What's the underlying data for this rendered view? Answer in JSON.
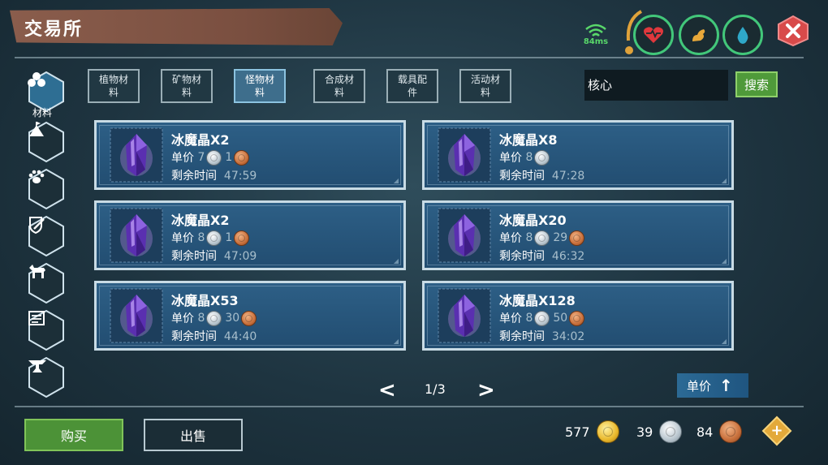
{
  "header": {
    "title": "交易所",
    "ping": "84ms",
    "status_icons": [
      "health-heart-icon",
      "stamina-arm-icon",
      "water-drop-icon"
    ],
    "close_icon": "close-x-icon"
  },
  "sidebar": {
    "active_label": "材料",
    "items": [
      "materials-cluster-icon",
      "mountain-flag-icon",
      "paw-icon",
      "shield-sword-icon",
      "horse-icon",
      "scroll-icon",
      "anvil-icon"
    ]
  },
  "tabs": [
    {
      "label": "植物材料",
      "active": false
    },
    {
      "label": "矿物材料",
      "active": false
    },
    {
      "label": "怪物材料",
      "active": true
    },
    {
      "label": "合成材料",
      "active": false
    },
    {
      "label": "载具配件",
      "active": false
    },
    {
      "label": "活动材料",
      "active": false
    }
  ],
  "search": {
    "value": "核心",
    "button_label": "搜索"
  },
  "listing_labels": {
    "price": "单价",
    "time": "剩余时间"
  },
  "listings": [
    {
      "name": "冰魔晶X2",
      "silver": "7",
      "copper": "1",
      "time": "47:59"
    },
    {
      "name": "冰魔晶X8",
      "silver": "8",
      "copper": "",
      "time": "47:28"
    },
    {
      "name": "冰魔晶X2",
      "silver": "8",
      "copper": "1",
      "time": "47:09"
    },
    {
      "name": "冰魔晶X20",
      "silver": "8",
      "copper": "29",
      "time": "46:32"
    },
    {
      "name": "冰魔晶X53",
      "silver": "8",
      "copper": "30",
      "time": "44:40"
    },
    {
      "name": "冰魔晶X128",
      "silver": "8",
      "copper": "50",
      "time": "34:02"
    }
  ],
  "pager": {
    "prev": "<",
    "text": "1/3",
    "next": ">"
  },
  "sort": {
    "label": "单价",
    "arrow": "↑"
  },
  "footer": {
    "buy_label": "购买",
    "sell_label": "出售",
    "gold": "577",
    "silver": "39",
    "copper": "84",
    "add": "+"
  },
  "colors": {
    "accent_green": "#4c9237",
    "card_blue": "#2d5f86",
    "title_banner": "#8a5d4c"
  }
}
